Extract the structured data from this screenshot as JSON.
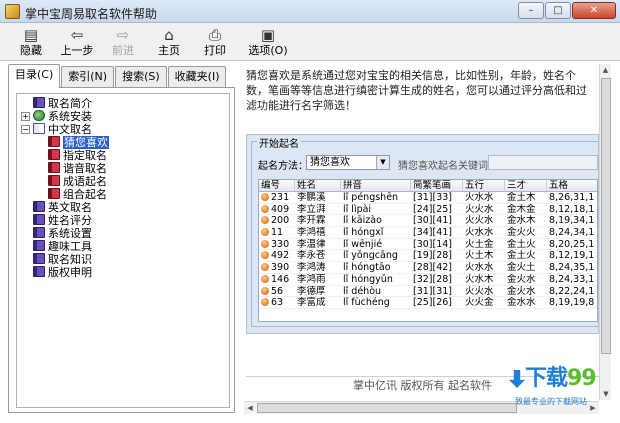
{
  "window": {
    "title": "掌中宝周易取名软件帮助",
    "controls": {
      "minimize": "–",
      "maximize": "□",
      "close": "✕"
    }
  },
  "toolbar": {
    "items": [
      {
        "label": "隐藏",
        "icon": "hide-icon",
        "glyph": "▤",
        "enabled": true
      },
      {
        "label": "上一步",
        "icon": "back-arrow-icon",
        "glyph": "⇦",
        "enabled": true
      },
      {
        "label": "前进",
        "icon": "forward-arrow-icon",
        "glyph": "⇨",
        "enabled": false
      },
      {
        "label": "主页",
        "icon": "home-icon",
        "glyph": "⌂",
        "enabled": true
      },
      {
        "label": "打印",
        "icon": "print-icon",
        "glyph": "⎙",
        "enabled": true
      },
      {
        "label": "选项(O)",
        "icon": "options-icon",
        "glyph": "▣",
        "enabled": true
      }
    ]
  },
  "tabs": [
    {
      "label": "目录(C)",
      "active": true
    },
    {
      "label": "索引(N)",
      "active": false
    },
    {
      "label": "搜索(S)",
      "active": false
    },
    {
      "label": "收藏夹(I)",
      "active": false
    }
  ],
  "tree": [
    {
      "label": "取名简介",
      "level": 0,
      "expander": "",
      "icon": "book"
    },
    {
      "label": "系统安装",
      "level": 0,
      "expander": "+",
      "icon": "globe"
    },
    {
      "label": "中文取名",
      "level": 0,
      "expander": "−",
      "icon": "open-book"
    },
    {
      "label": "猜您喜欢",
      "level": 1,
      "expander": "",
      "icon": "red-book",
      "selected": true
    },
    {
      "label": "指定取名",
      "level": 1,
      "expander": "",
      "icon": "red-book"
    },
    {
      "label": "谐音取名",
      "level": 1,
      "expander": "",
      "icon": "red-book"
    },
    {
      "label": "成语起名",
      "level": 1,
      "expander": "",
      "icon": "red-book"
    },
    {
      "label": "组合起名",
      "level": 1,
      "expander": "",
      "icon": "red-book"
    },
    {
      "label": "英文取名",
      "level": 0,
      "expander": "",
      "icon": "book"
    },
    {
      "label": "姓名评分",
      "level": 0,
      "expander": "",
      "icon": "book"
    },
    {
      "label": "系统设置",
      "level": 0,
      "expander": "",
      "icon": "book"
    },
    {
      "label": "趣味工具",
      "level": 0,
      "expander": "",
      "icon": "book"
    },
    {
      "label": "取名知识",
      "level": 0,
      "expander": "",
      "icon": "book"
    },
    {
      "label": "版权申明",
      "level": 0,
      "expander": "",
      "icon": "book"
    }
  ],
  "content": {
    "intro": "猜您喜欢是系统通过您对宝宝的相关信息，比如性别，年龄，姓名个数，笔画等等信息进行缜密计算生成的姓名，您可以通过评分高低和过滤功能进行名字筛选！",
    "footer": "掌中亿讯  版权所有  起名软件"
  },
  "screenshot": {
    "group_title": "开始起名",
    "method_label": "起名方法：",
    "method_value": "猜您喜欢",
    "keyword_label": "猜您喜欢起名关键词：",
    "columns": [
      "编号",
      "姓名",
      "拼音",
      "简繁笔画",
      "五行",
      "三才",
      "五格"
    ],
    "rows": [
      [
        "231",
        "李鹏溪",
        "lǐ péngshēn",
        "[31][33]",
        "火水水",
        "金土木",
        "8,26,31,1"
      ],
      [
        "409",
        "李立湃",
        "lǐ lìpài",
        "[24][25]",
        "火火水",
        "金木金",
        "8,12,18,1"
      ],
      [
        "200",
        "李开霖",
        "lǐ kāizào",
        "[30][41]",
        "火火水",
        "金水木",
        "8,19,34,1"
      ],
      [
        "11",
        "李鸿禧",
        "lǐ hóngxǐ",
        "[34][41]",
        "火水水",
        "金火火",
        "8,24,34,1"
      ],
      [
        "330",
        "李温律",
        "lǐ wēnjié",
        "[30][14]",
        "火土金",
        "金土火",
        "8,20,25,1"
      ],
      [
        "492",
        "李永苍",
        "lǐ yǒngcāng",
        "[19][28]",
        "火土木",
        "金土火",
        "8,12,19,1"
      ],
      [
        "390",
        "李鸿涛",
        "lǐ hóngtāo",
        "[28][42]",
        "火水水",
        "金火土",
        "8,24,35,1"
      ],
      [
        "146",
        "李鸿雨",
        "lǐ hóngyǔn",
        "[32][28]",
        "火水木",
        "金火水",
        "8,24,33,1"
      ],
      [
        "56",
        "李德厚",
        "lǐ déhòu",
        "[31][31]",
        "火火水",
        "金火水",
        "8,22,24,1"
      ],
      [
        "63",
        "李富成",
        "lǐ fùchéng",
        "[25][26]",
        "火火金",
        "金水水",
        "8,19,19,8"
      ]
    ]
  },
  "watermark": {
    "brand_part1": "下载",
    "brand_part2": "99",
    "tagline": "致最专业的下载网站"
  },
  "colors": {
    "selection": "#2a5fc8",
    "brand_blue": "#1e7fd8",
    "brand_green": "#5bbd2c"
  }
}
